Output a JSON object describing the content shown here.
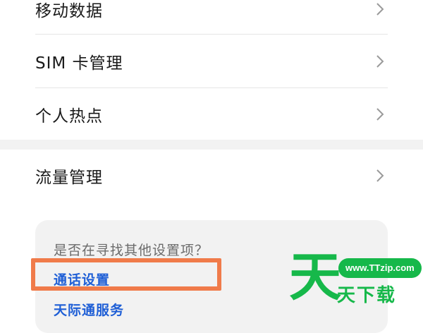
{
  "settings_list": {
    "items": [
      {
        "label": "移动数据"
      },
      {
        "label": "SIM 卡管理"
      },
      {
        "label": "个人热点"
      },
      {
        "label": "流量管理"
      }
    ]
  },
  "suggestions": {
    "title": "是否在寻找其他设置项？",
    "links": [
      {
        "label": "通话设置"
      },
      {
        "label": "天际通服务"
      }
    ]
  },
  "watermark": {
    "big_char": "天",
    "url": "www.TTzip.com",
    "sub_text": "天下载"
  },
  "colors": {
    "link": "#1f5fd6",
    "highlight": "#f07b4a",
    "watermark": "#16b84a"
  },
  "icons": {
    "chevron": "chevron-right-icon"
  }
}
